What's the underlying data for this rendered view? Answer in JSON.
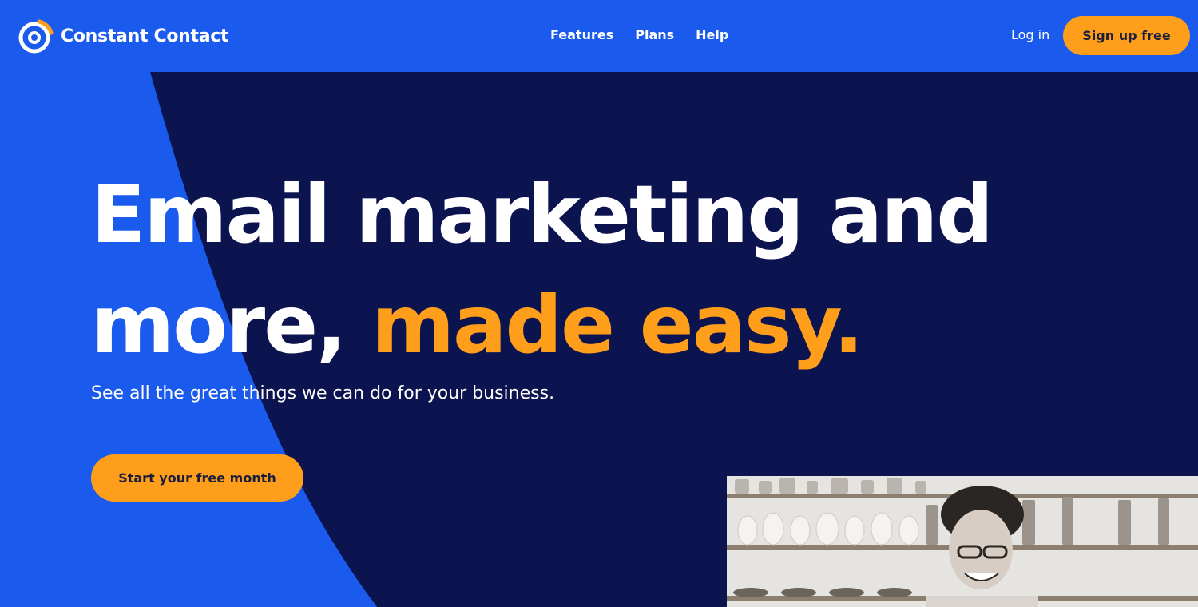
{
  "brand": {
    "name": "Constant Contact",
    "logo_icon": "constant-contact-logo-icon"
  },
  "nav": {
    "items": [
      {
        "label": "Features"
      },
      {
        "label": "Plans"
      },
      {
        "label": "Help"
      }
    ]
  },
  "header": {
    "login_label": "Log in",
    "signup_label": "Sign up free"
  },
  "hero": {
    "headline_line1": "Email marketing and",
    "headline_line2_lead": "more, ",
    "headline_line2_accent": "made easy.",
    "subtext": "See all the great things we can do for your business.",
    "cta_label": "Start your free month"
  },
  "colors": {
    "brand_blue": "#1a5aed",
    "navy": "#0c1450",
    "accent_orange": "#ff9e1b",
    "button_text": "#1b1f3b"
  }
}
